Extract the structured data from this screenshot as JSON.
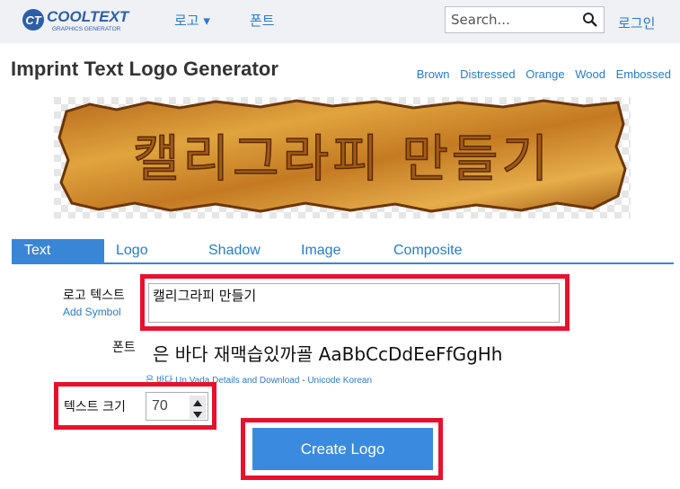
{
  "header": {
    "logo_text": "COOLTEXT",
    "logo_subtext": "GRAPHICS GENERATOR",
    "nav_logo": "로고 ▾",
    "nav_fonts": "폰트",
    "search_placeholder": "Search...",
    "login": "로그인"
  },
  "page": {
    "title": "Imprint Text Logo Generator",
    "styles": [
      "Brown",
      "Distressed",
      "Orange",
      "Wood",
      "Embossed"
    ]
  },
  "preview": {
    "text": "캘리그라피 만들기"
  },
  "tabs": [
    {
      "label": "Text"
    },
    {
      "label": "Logo"
    },
    {
      "label": "Shadow"
    },
    {
      "label": "Image"
    },
    {
      "label": "Composite"
    }
  ],
  "form": {
    "logo_text_label": "로고 텍스트",
    "logo_text_value": "캘리그라피 만들기",
    "add_symbol": "Add Symbol",
    "font_label": "폰트",
    "font_preview": "은 바다 재맥습있까굘 AaBbCcDdEeFfGgHh",
    "font_name": "은 바다",
    "font_details": "Un Vada Details and Download",
    "font_separator": "-",
    "font_category": "Unicode Korean",
    "text_size_label": "텍스트 크기",
    "text_size_value": "70",
    "create_button": "Create Logo"
  },
  "colors": {
    "accent": "#3a86d6",
    "highlight": "#e8112d",
    "link": "#2a7bc8"
  }
}
